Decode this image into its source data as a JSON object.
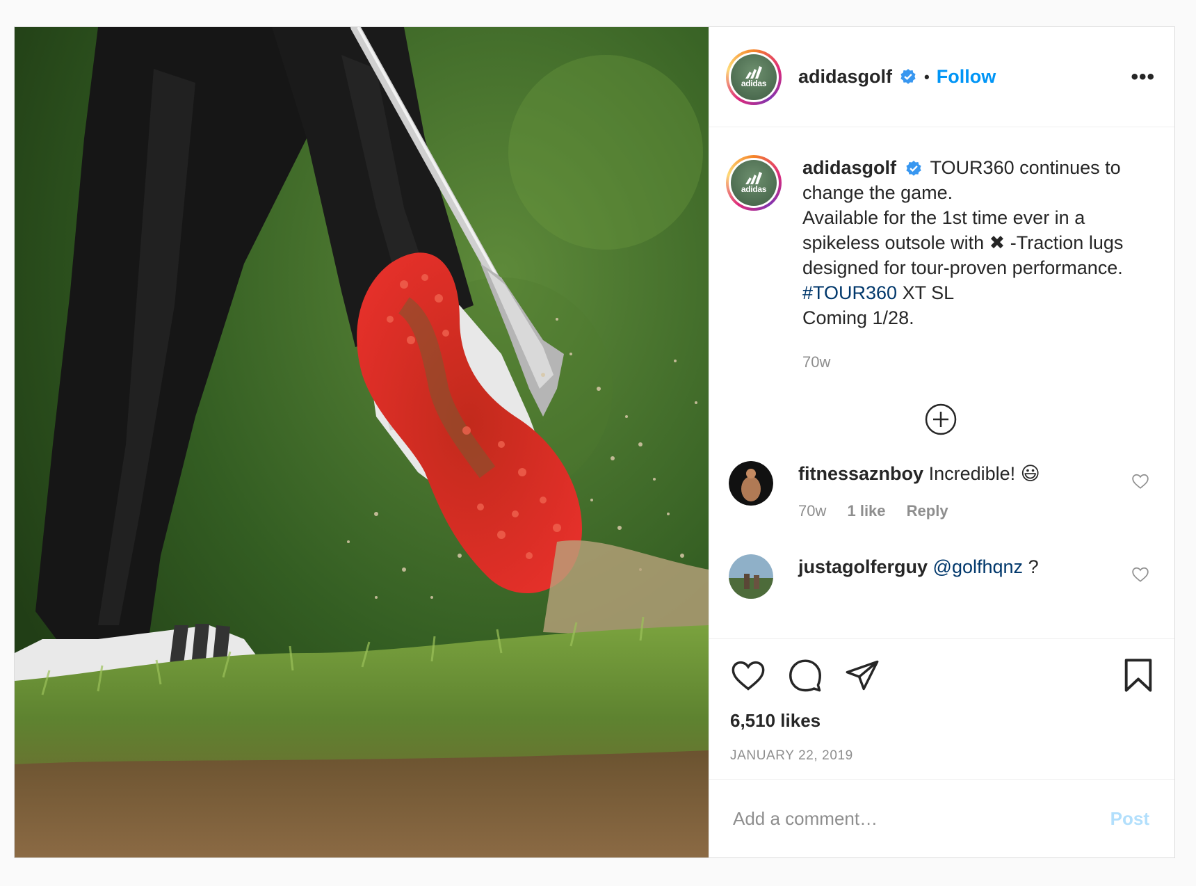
{
  "post": {
    "username": "adidasgolf",
    "separator": "•",
    "follow_label": "Follow",
    "more_label": "•••",
    "avatar_text": "adidas",
    "caption": {
      "username": "adidasgolf",
      "line1": "TOUR360 continues to change the game.",
      "line2": "Available for the 1st time ever in a spikeless outsole with",
      "line2_symbol": "✖",
      "line2_rest": "-Traction lugs designed for tour-proven performance.",
      "hashtag": "#TOUR360",
      "hashtag_rest": "XT SL",
      "line4": "Coming 1/28.",
      "time": "70w"
    },
    "comments": [
      {
        "username": "fitnessaznboy",
        "text": "Incredible!",
        "emoji": "😃",
        "time": "70w",
        "likes": "1 like",
        "reply": "Reply"
      },
      {
        "username": "justagolferguy",
        "mention": "@golfhqnz",
        "text": "?"
      }
    ],
    "likes": "6,510 likes",
    "date": "JANUARY 22, 2019",
    "comment_placeholder": "Add a comment…",
    "post_label": "Post",
    "colors": {
      "accent": "#0095f6",
      "hashtag": "#00376b",
      "muted": "#8e8e8e",
      "post_disabled": "#b2dffc",
      "sole_red": "#e0271e"
    },
    "icons": [
      "verified-badge-icon",
      "more-options-icon",
      "load-more-icon",
      "heart-icon",
      "comment-icon",
      "share-icon",
      "bookmark-icon"
    ]
  }
}
